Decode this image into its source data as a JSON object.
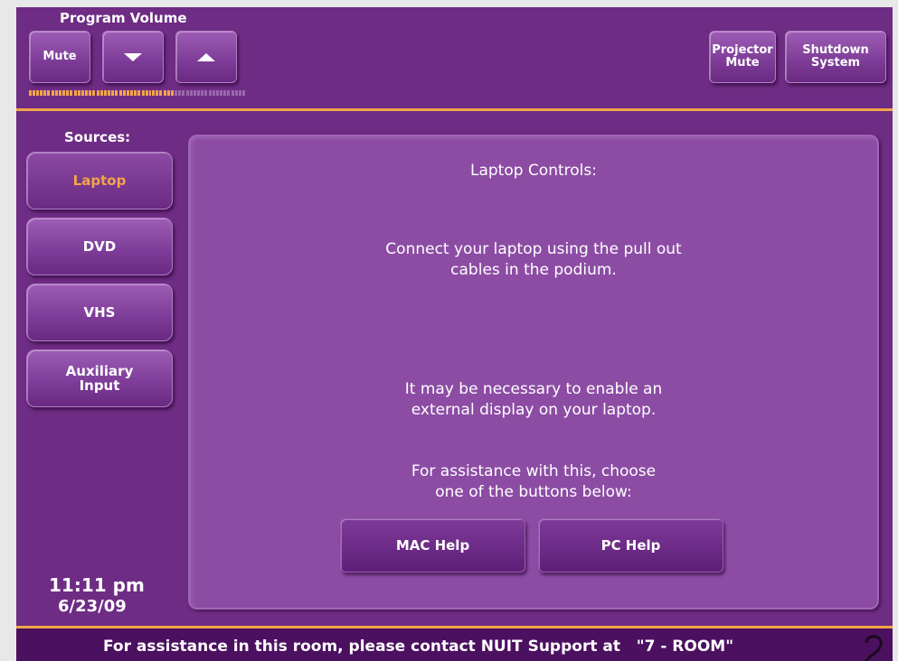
{
  "colors": {
    "panel_bg": "#6e2c84",
    "accent_orange": "#f2a54a",
    "content_bg": "#8c4ca4",
    "meter_on": "#f2a54a",
    "meter_off": "#9a68ad"
  },
  "header": {
    "volume_title": "Program Volume",
    "mute_label": "Mute",
    "volume_down_icon": "triangle-down",
    "volume_up_icon": "triangle-up",
    "volume_level": 0.68,
    "projector_mute_label": "Projector\nMute",
    "shutdown_label": "Shutdown\nSystem"
  },
  "sidebar": {
    "title": "Sources:",
    "items": [
      {
        "label": "Laptop",
        "selected": true
      },
      {
        "label": "DVD",
        "selected": false
      },
      {
        "label": "VHS",
        "selected": false
      },
      {
        "label": "Auxiliary\nInput",
        "selected": false
      }
    ],
    "time": "11:11 pm",
    "date": "6/23/09"
  },
  "content": {
    "title": "Laptop Controls:",
    "instruction": "Connect your laptop using the pull out\ncables in the podium.",
    "note": "It may be necessary to enable an\nexternal display on your laptop.",
    "assist": "For assistance with this, choose\none of the buttons below:",
    "mac_help_label": "MAC Help",
    "pc_help_label": "PC Help"
  },
  "footer": {
    "text": "For assistance in this room, please contact NUIT Support at   \"7 - ROOM\""
  }
}
